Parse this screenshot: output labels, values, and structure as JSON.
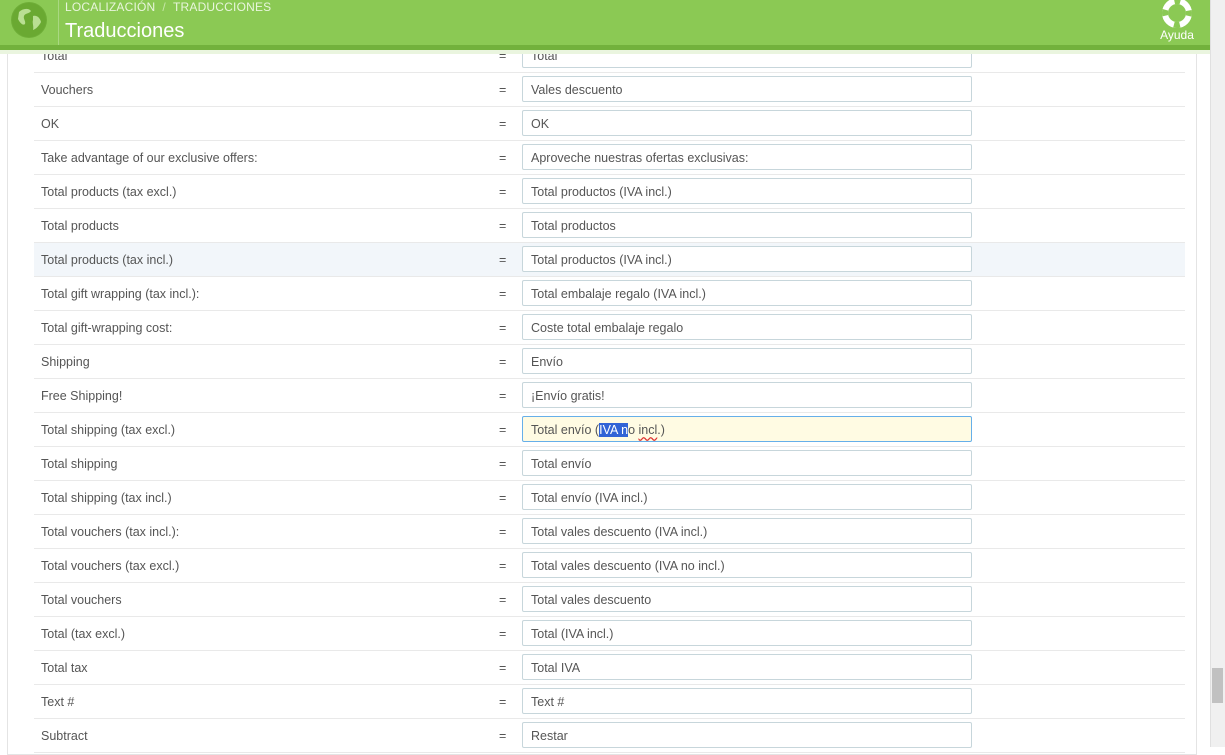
{
  "header": {
    "breadcrumb": [
      "LOCALIZACIÓN",
      "TRADUCCIONES"
    ],
    "title": "Traducciones",
    "help_label": "Ayuda",
    "accent": "#8bc954"
  },
  "rows": [
    {
      "source": "Total",
      "eq": "=",
      "value": "Total"
    },
    {
      "source": "Vouchers",
      "eq": "=",
      "value": "Vales descuento"
    },
    {
      "source": "OK",
      "eq": "=",
      "value": "OK"
    },
    {
      "source": "Take advantage of our exclusive offers:",
      "eq": "=",
      "value": "Aproveche nuestras ofertas exclusivas:"
    },
    {
      "source": "Total products (tax excl.)",
      "eq": "=",
      "value": "Total productos (IVA incl.)"
    },
    {
      "source": "Total products",
      "eq": "=",
      "value": "Total productos"
    },
    {
      "source": "Total products (tax incl.)",
      "eq": "=",
      "value": "Total productos (IVA incl.)"
    },
    {
      "source": "Total gift wrapping (tax incl.):",
      "eq": "=",
      "value": "Total embalaje regalo (IVA incl.)"
    },
    {
      "source": "Total gift-wrapping cost:",
      "eq": "=",
      "value": "Coste total embalaje regalo"
    },
    {
      "source": "Shipping",
      "eq": "=",
      "value": "Envío"
    },
    {
      "source": "Free Shipping!",
      "eq": "=",
      "value": "¡Envío gratis!"
    },
    {
      "source": "Total shipping (tax excl.)",
      "eq": "=",
      "value": "Total envío (IVA no incl.)"
    },
    {
      "source": "Total shipping",
      "eq": "=",
      "value": "Total envío"
    },
    {
      "source": "Total shipping (tax incl.)",
      "eq": "=",
      "value": "Total envío (IVA incl.)"
    },
    {
      "source": "Total vouchers (tax incl.):",
      "eq": "=",
      "value": "Total vales descuento (IVA incl.)"
    },
    {
      "source": "Total vouchers (tax excl.)",
      "eq": "=",
      "value": "Total vales descuento (IVA no incl.)"
    },
    {
      "source": "Total vouchers",
      "eq": "=",
      "value": "Total vales descuento"
    },
    {
      "source": "Total (tax excl.)",
      "eq": "=",
      "value": "Total (IVA incl.)"
    },
    {
      "source": "Total tax",
      "eq": "=",
      "value": "Total IVA"
    },
    {
      "source": "Text #",
      "eq": "=",
      "value": "Text #"
    },
    {
      "source": "Subtract",
      "eq": "=",
      "value": "Restar"
    }
  ],
  "focused_input": {
    "before": "Total envío (",
    "selected": "IVA n",
    "after_plain": "o ",
    "misspelled": "incl",
    "tail": ".)"
  }
}
